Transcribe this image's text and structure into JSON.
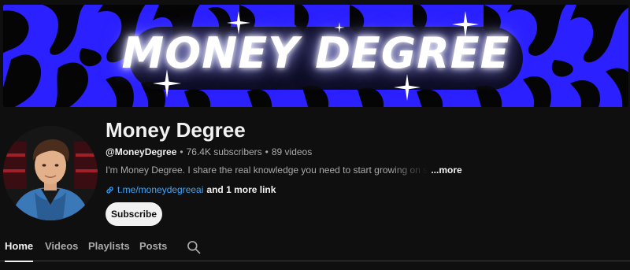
{
  "banner": {
    "title": "MONEY DEGREE"
  },
  "channel": {
    "name": "Money Degree",
    "handle": "@MoneyDegree",
    "subscribers": "76.4K subscribers",
    "videos": "89 videos",
    "separator": "•",
    "description": "I'm Money Degree. I share the real knowledge you need to start growing on social media and",
    "more_label": "...more",
    "link_text": "t.me/moneydegreeai",
    "more_links": "and 1 more link",
    "subscribe_label": "Subscribe"
  },
  "tabs": [
    {
      "label": "Home",
      "active": true
    },
    {
      "label": "Videos",
      "active": false
    },
    {
      "label": "Playlists",
      "active": false
    },
    {
      "label": "Posts",
      "active": false
    }
  ],
  "colors": {
    "background": "#0f0f0f",
    "banner_blue": "#2b20ff",
    "link_blue": "#3ea6ff",
    "subscribe_bg": "#f1f1f1"
  },
  "icons": {
    "link": "link-icon",
    "search": "search-icon"
  }
}
